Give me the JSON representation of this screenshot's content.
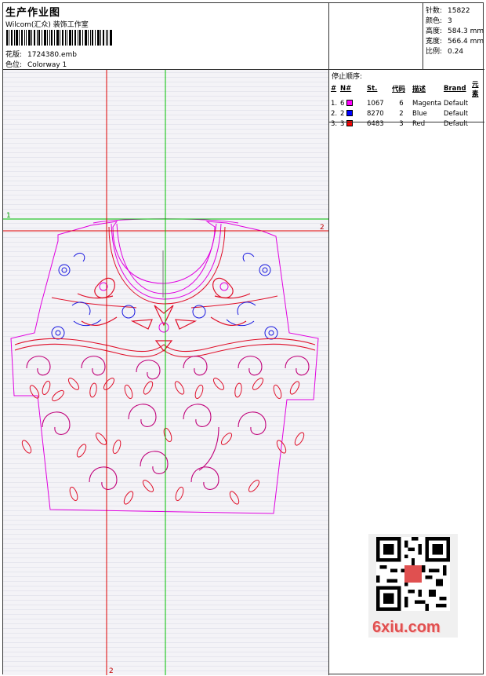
{
  "header": {
    "title": "生产作业图",
    "company": "Wilcom(汇众) 装饰工作室",
    "design_label": "花版:",
    "design_value": "1724380.emb",
    "colorway_label": "色位:",
    "colorway_value": "Colorway 1"
  },
  "stats": [
    {
      "label": "针数:",
      "value": "15822"
    },
    {
      "label": "颜色:",
      "value": "3"
    },
    {
      "label": "高度:",
      "value": "584.3 mm"
    },
    {
      "label": "宽度:",
      "value": "566.4 mm"
    },
    {
      "label": "比例:",
      "value": "0.24"
    }
  ],
  "stop_sequence": {
    "heading": "停止顺序:",
    "columns": [
      "#",
      "N#",
      "St.",
      "代码",
      "描述",
      "Brand",
      "元素"
    ],
    "rows": [
      {
        "num": "1.",
        "needle": "6",
        "color": "#ff00ff",
        "stitches": "1067",
        "code": "6",
        "desc": "Magenta",
        "brand": "Default"
      },
      {
        "num": "2.",
        "needle": "2",
        "color": "#0000ff",
        "stitches": "8270",
        "code": "2",
        "desc": "Blue",
        "brand": "Default"
      },
      {
        "num": "3.",
        "needle": "3",
        "color": "#ff0000",
        "stitches": "6483",
        "code": "3",
        "desc": "Red",
        "brand": "Default"
      }
    ]
  },
  "guides": {
    "h_green_label": "1",
    "h_red_label": "2",
    "v_red_label": "2"
  },
  "colors": {
    "magenta": "#e000e0",
    "blue": "#1a1ae0",
    "red": "#e0102a",
    "green": "#00c000",
    "guide_red": "#e00000"
  },
  "watermark": "6xiu.com"
}
